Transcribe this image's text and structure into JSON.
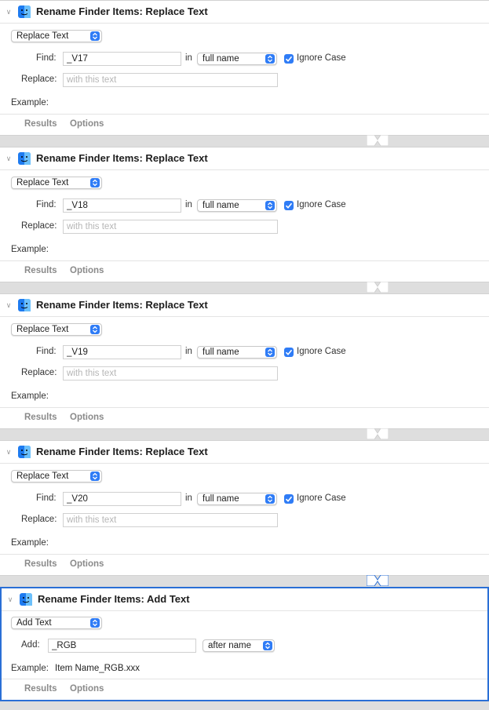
{
  "actions": [
    {
      "title": "Rename Finder Items: Replace Text",
      "mode": "Replace Text",
      "find_label": "Find:",
      "find_value": "_V17",
      "in_label": "in",
      "in_value": "full name",
      "ignore_case_label": "Ignore Case",
      "ignore_case": true,
      "replace_label": "Replace:",
      "replace_placeholder": "with this text",
      "replace_value": "",
      "example_label": "Example:",
      "results_label": "Results",
      "options_label": "Options"
    },
    {
      "title": "Rename Finder Items: Replace Text",
      "mode": "Replace Text",
      "find_label": "Find:",
      "find_value": "_V18",
      "in_label": "in",
      "in_value": "full name",
      "ignore_case_label": "Ignore Case",
      "ignore_case": true,
      "replace_label": "Replace:",
      "replace_placeholder": "with this text",
      "replace_value": "",
      "example_label": "Example:",
      "results_label": "Results",
      "options_label": "Options"
    },
    {
      "title": "Rename Finder Items: Replace Text",
      "mode": "Replace Text",
      "find_label": "Find:",
      "find_value": "_V19",
      "in_label": "in",
      "in_value": "full name",
      "ignore_case_label": "Ignore Case",
      "ignore_case": true,
      "replace_label": "Replace:",
      "replace_placeholder": "with this text",
      "replace_value": "",
      "example_label": "Example:",
      "results_label": "Results",
      "options_label": "Options"
    },
    {
      "title": "Rename Finder Items: Replace Text",
      "mode": "Replace Text",
      "find_label": "Find:",
      "find_value": "_V20",
      "in_label": "in",
      "in_value": "full name",
      "ignore_case_label": "Ignore Case",
      "ignore_case": true,
      "replace_label": "Replace:",
      "replace_placeholder": "with this text",
      "replace_value": "",
      "example_label": "Example:",
      "results_label": "Results",
      "options_label": "Options"
    },
    {
      "title": "Rename Finder Items: Add Text",
      "mode": "Add Text",
      "add_label": "Add:",
      "add_value": "_RGB",
      "position_value": "after name",
      "example_label": "Example:",
      "example_value": "Item Name_RGB.xxx",
      "results_label": "Results",
      "options_label": "Options"
    }
  ],
  "colors": {
    "accent": "#2f7cf6",
    "selection_border": "#2a6fd6",
    "background": "#dedede"
  },
  "icons": {
    "action_icon": "finder-icon",
    "disclosure": "chevron-down-icon",
    "checkbox": "checkmark-icon",
    "popup": "up-down-chevron-icon"
  }
}
